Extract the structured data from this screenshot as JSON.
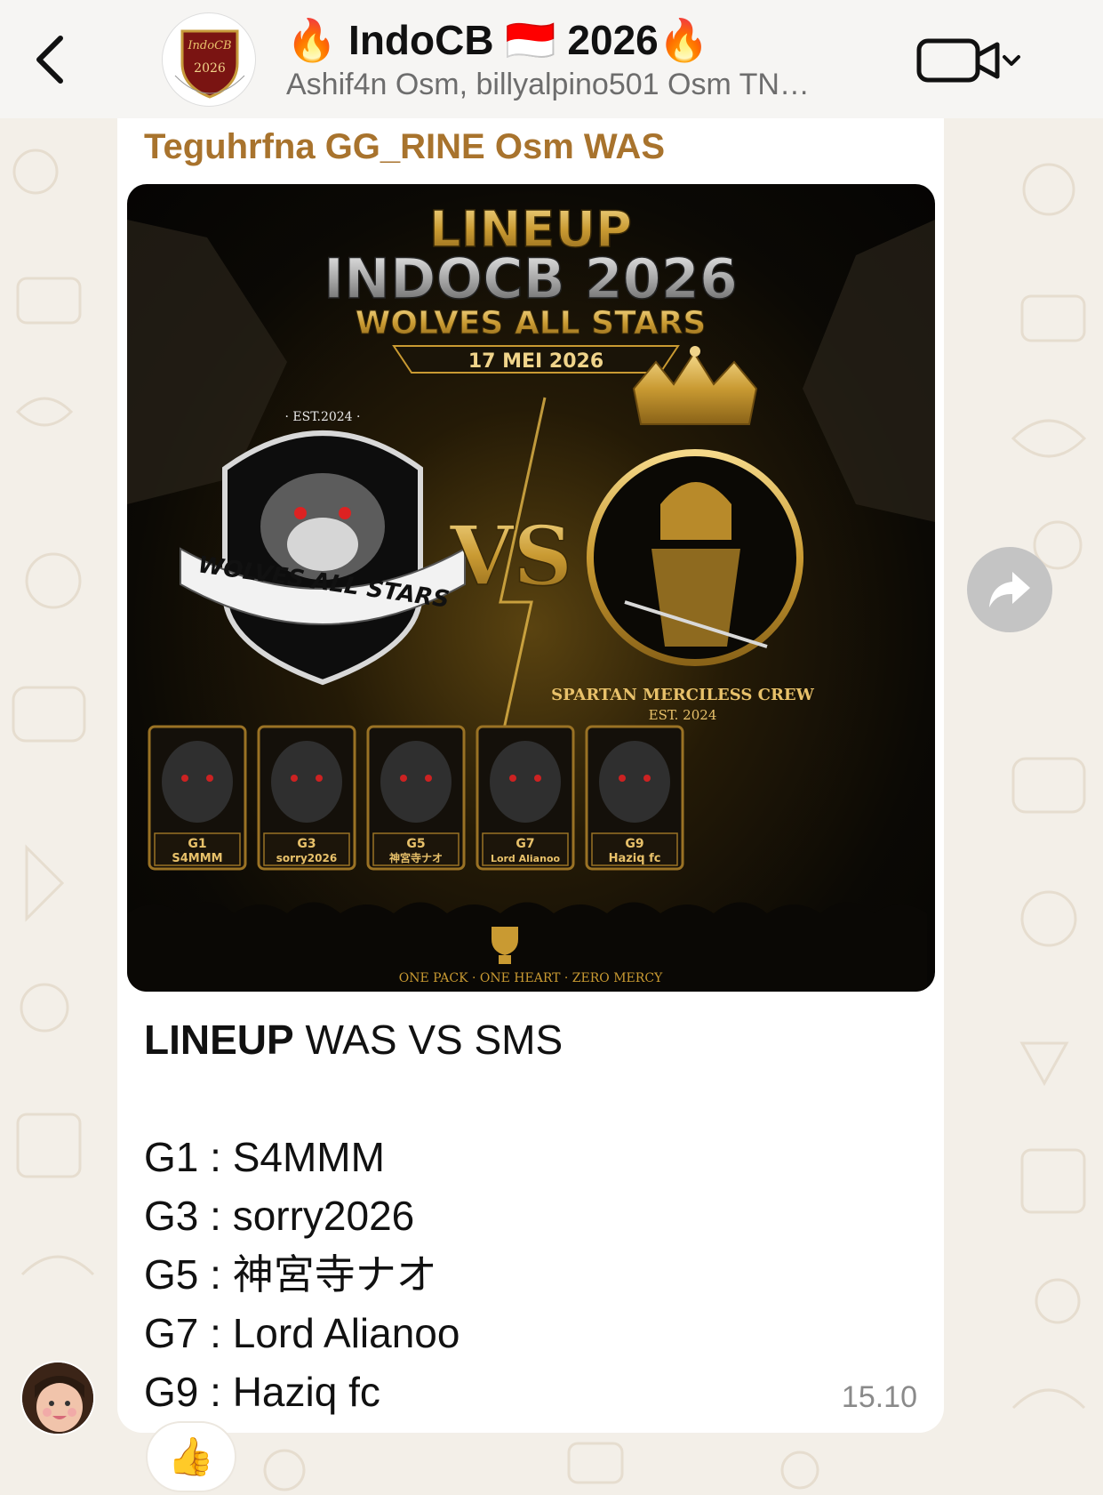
{
  "header": {
    "title": "🔥 IndoCB 🇮🇩 2026🔥",
    "subtitle": "Ashif4n Osm, billyalpino501 Osm TN…",
    "avatar_year": "2026",
    "avatar_brand": "IndoCB",
    "back_icon": "chevron-left-icon",
    "video_icon": "video-camera-icon"
  },
  "message": {
    "sender": "Teguhrfna GG_RINE Osm WAS",
    "time": "15.10",
    "title_bold": "LINEUP",
    "title_rest": " WAS VS SMS",
    "lines": [
      "G1 : S4MMM",
      "G3 : sorry2026",
      "G5 : 神宮寺ナオ",
      "G7 : Lord Alianoo",
      "G9 : Haziq fc"
    ],
    "reaction": "👍"
  },
  "poster": {
    "title1": "LINEUP",
    "title2": "INDOCB 2026",
    "title3": "WOLVES ALL STARS",
    "date": "17 MEI 2026",
    "vs": "VS",
    "wolf_est": "· EST.2024 ·",
    "wolf_banner": "WOLVES ALL STARS",
    "spartan_name": "SPARTAN MERCILESS CREW",
    "spartan_est": "EST. 2024",
    "footer": "ONE PACK  ·  ONE HEART  ·  ZERO MERCY",
    "cards": [
      {
        "slot": "G1",
        "name": "S4MMM"
      },
      {
        "slot": "G3",
        "name": "sorry2026"
      },
      {
        "slot": "G5",
        "name": "神宮寺ナオ"
      },
      {
        "slot": "G7",
        "name": "Lord Alianoo"
      },
      {
        "slot": "G9",
        "name": "Haziq fc"
      }
    ]
  },
  "colors": {
    "sender": "#a8732d",
    "gold": "#d9a93c",
    "bubble": "#ffffff",
    "wallpaper": "#f3efe8"
  }
}
